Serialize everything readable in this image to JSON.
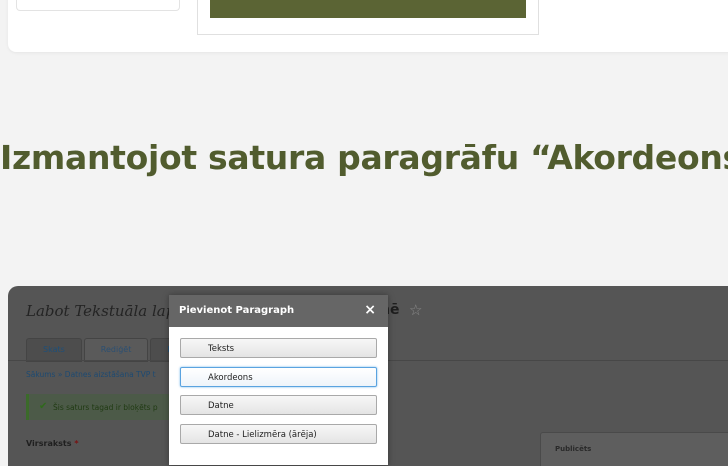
{
  "heading": "Izmantojot satura paragrāfu “Akordeons”:",
  "screenshot": {
    "page_title": "Labot Tekstuāla lapa",
    "page_title_tail": "nē",
    "tabs": [
      {
        "label": "Skats"
      },
      {
        "label": "Rediģēt"
      },
      {
        "label": "D"
      }
    ],
    "breadcrumb": "Sākums » Datnes aizstāšana TVP t",
    "message": "Šis saturs tagad ir bloķēts p",
    "field_label": "Virsraksts",
    "field_required": "*",
    "right_panel_label": "Publicēts"
  },
  "modal": {
    "title": "Pievienot Paragraph",
    "close": "×",
    "buttons": [
      {
        "label": "Teksts"
      },
      {
        "label": "Akordeons"
      },
      {
        "label": "Datne"
      },
      {
        "label": "Datne - Lielizmēra (ārēja)"
      }
    ]
  }
}
